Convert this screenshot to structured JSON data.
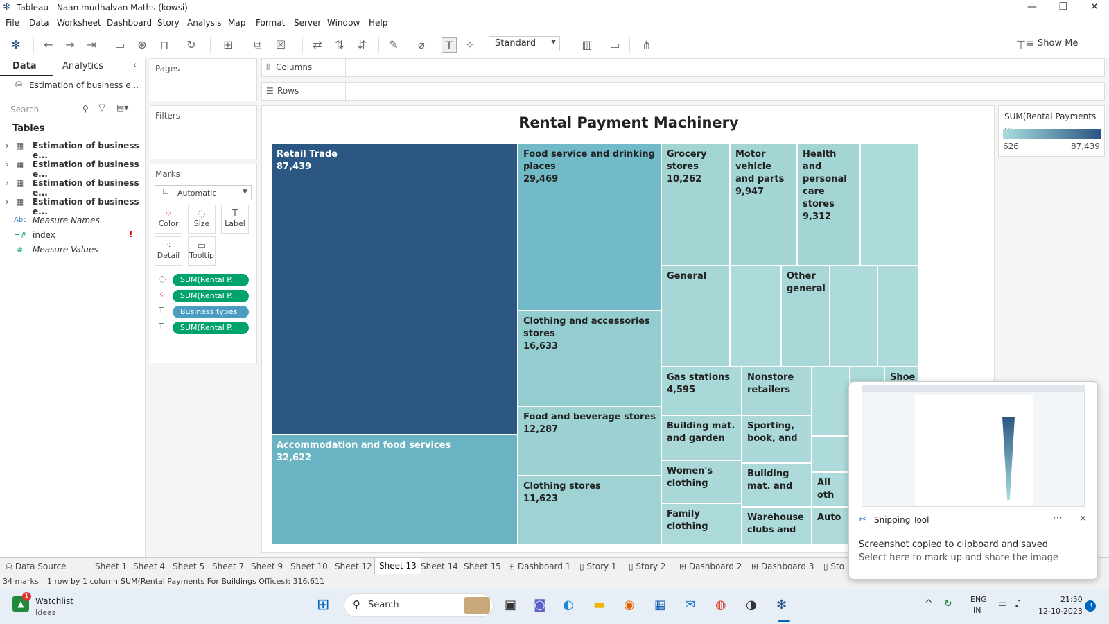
{
  "window": {
    "title": "Tableau - Naan mudhalvan Maths (kowsi)"
  },
  "menu": [
    "File",
    "Data",
    "Worksheet",
    "Dashboard",
    "Story",
    "Analysis",
    "Map",
    "Format",
    "Server",
    "Window",
    "Help"
  ],
  "toolbar": {
    "view_select": "Standard",
    "show_me": "Show Me"
  },
  "left_pane": {
    "tabs": [
      "Data",
      "Analytics"
    ],
    "datasource": "Estimation of business e...",
    "search_placeholder": "Search",
    "tables_heading": "Tables",
    "tables": [
      "Estimation of business e...",
      "Estimation of business e...",
      "Estimation of business e...",
      "Estimation of business e..."
    ],
    "fields": [
      {
        "type": "Abc",
        "name": "Measure Names"
      },
      {
        "type": "=#",
        "name": "index"
      },
      {
        "type": "#",
        "name": "Measure Values"
      }
    ]
  },
  "shelves": {
    "pages": "Pages",
    "filters": "Filters",
    "marks": "Marks",
    "columns": "Columns",
    "rows": "Rows"
  },
  "marks": {
    "type": "Automatic",
    "buttons": [
      "Color",
      "Size",
      "Label",
      "Detail",
      "Tooltip"
    ],
    "pills": [
      "SUM(Rental P..",
      "SUM(Rental P..",
      "Business types",
      "SUM(Rental P.."
    ]
  },
  "chart_data": {
    "type": "treemap",
    "title": "Rental Payment Machinery",
    "color_measure": "SUM(Rental Payments For Buildings Offices)",
    "color_range": [
      626,
      87439
    ],
    "color_scale": [
      "#a8dede",
      "#2a5582"
    ],
    "tiles": [
      {
        "name": "Retail Trade",
        "value": 87439,
        "color": "#2c5782"
      },
      {
        "name": "Accommodation and food services",
        "value": 32622,
        "color": "#69b3c3"
      },
      {
        "name": "Food service and drinking places",
        "value": 29469,
        "color": "#72bac7"
      },
      {
        "name": "Clothing and accessories stores",
        "value": 16633,
        "color": "#93cdd0"
      },
      {
        "name": "Food and beverage stores",
        "value": 12287,
        "color": "#9dd2d2"
      },
      {
        "name": "Clothing stores",
        "value": 11623,
        "color": "#9fd3d3"
      },
      {
        "name": "Grocery stores",
        "value": 10262,
        "color": "#a2d4d4"
      },
      {
        "name": "Motor vehicle and parts",
        "value": 9947,
        "color": "#a3d5d5"
      },
      {
        "name": "Health and personal care stores",
        "value": 9312,
        "color": "#a4d5d5"
      },
      {
        "name": "General",
        "value": null,
        "color": "#a6d6d6"
      },
      {
        "name": "Other general",
        "value": null,
        "color": "#a7d7d7"
      },
      {
        "name": "Gas stations",
        "value": 4595,
        "color": "#a9d8d8"
      },
      {
        "name": "Nonstore retailers",
        "value": null,
        "color": "#aad8d8"
      },
      {
        "name": "Shoe",
        "value": null,
        "color": "#acd9d9"
      },
      {
        "name": "Building mat. and garden",
        "value": null,
        "color": "#aad8d8"
      },
      {
        "name": "Sporting, book, and",
        "value": null,
        "color": "#abd9d9"
      },
      {
        "name": "Women's clothing",
        "value": null,
        "color": "#abd9d9"
      },
      {
        "name": "Building mat. and",
        "value": null,
        "color": "#acd9d9"
      },
      {
        "name": "All oth",
        "value": null,
        "color": "#addada"
      },
      {
        "name": "Family clothing",
        "value": null,
        "color": "#acd9d9"
      },
      {
        "name": "Warehouse clubs and",
        "value": null,
        "color": "#addada"
      },
      {
        "name": "Auto",
        "value": null,
        "color": "#aedada"
      }
    ]
  },
  "legend": {
    "title": "SUM(Rental Payments ...",
    "min": "626",
    "max": "87,439"
  },
  "sheet_tabs": [
    "Data Source",
    "Sheet 1",
    "Sheet 4",
    "Sheet 5",
    "Sheet 7",
    "Sheet 9",
    "Sheet 10",
    "Sheet 12",
    "Sheet 13",
    "Sheet 14",
    "Sheet 15",
    "Dashboard 1",
    "Story 1",
    "Story 2",
    "Dashboard 2",
    "Dashboard 3",
    "Sto"
  ],
  "active_sheet": "Sheet 13",
  "status": {
    "marks": "34 marks",
    "dims": "1 row by 1 column",
    "sum": "SUM(Rental Payments For Buildings Offices): 316,611"
  },
  "toast": {
    "app": "Snipping Tool",
    "line1": "Screenshot copied to clipboard and saved",
    "line2": "Select here to mark up and share the image"
  },
  "taskbar": {
    "widget_title": "Watchlist",
    "widget_sub": "Ideas",
    "widget_badge": "1",
    "search": "Search",
    "lang1": "ENG",
    "lang2": "IN",
    "time": "21:50",
    "date": "12-10-2023",
    "notif": "3"
  }
}
